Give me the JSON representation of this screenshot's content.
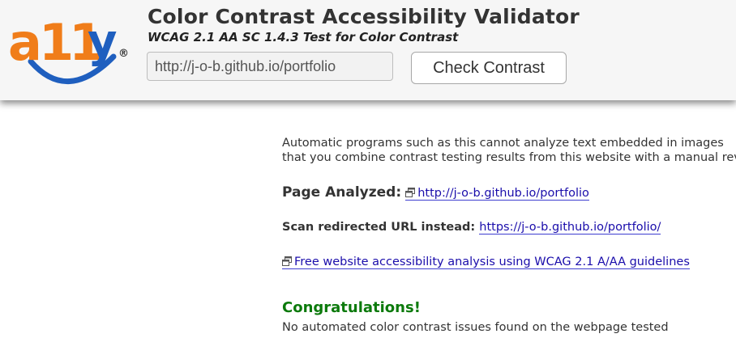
{
  "header": {
    "logo_text": "a11y",
    "logo_mark": "®",
    "title": "Color Contrast Accessibility Validator",
    "subtitle": "WCAG 2.1 AA SC 1.4.3 Test for Color Contrast",
    "url_input_value": "http://j-o-b.github.io/portfolio",
    "check_button_label": "Check Contrast"
  },
  "content": {
    "intro_line1": "Automatic programs such as this cannot analyze text embedded in images",
    "intro_line2": "that you combine contrast testing results from this website with a manual review.",
    "page_analyzed_label": "Page Analyzed:",
    "page_analyzed_url": "http://j-o-b.github.io/portfolio",
    "redirect_label": "Scan redirected URL instead:",
    "redirect_url": "https://j-o-b.github.io/portfolio/",
    "free_analysis_link": "Free website accessibility analysis using WCAG 2.1 A/AA guidelines",
    "congrats_heading": "Congratulations!",
    "no_issues_text": "No automated color contrast issues found on the webpage tested"
  },
  "colors": {
    "logo_orange": "#f07d1a",
    "logo_blue": "#1f5fbf",
    "link": "#1a0dab",
    "success": "#0c7a0c"
  },
  "icons": [
    "external-window-icon"
  ]
}
